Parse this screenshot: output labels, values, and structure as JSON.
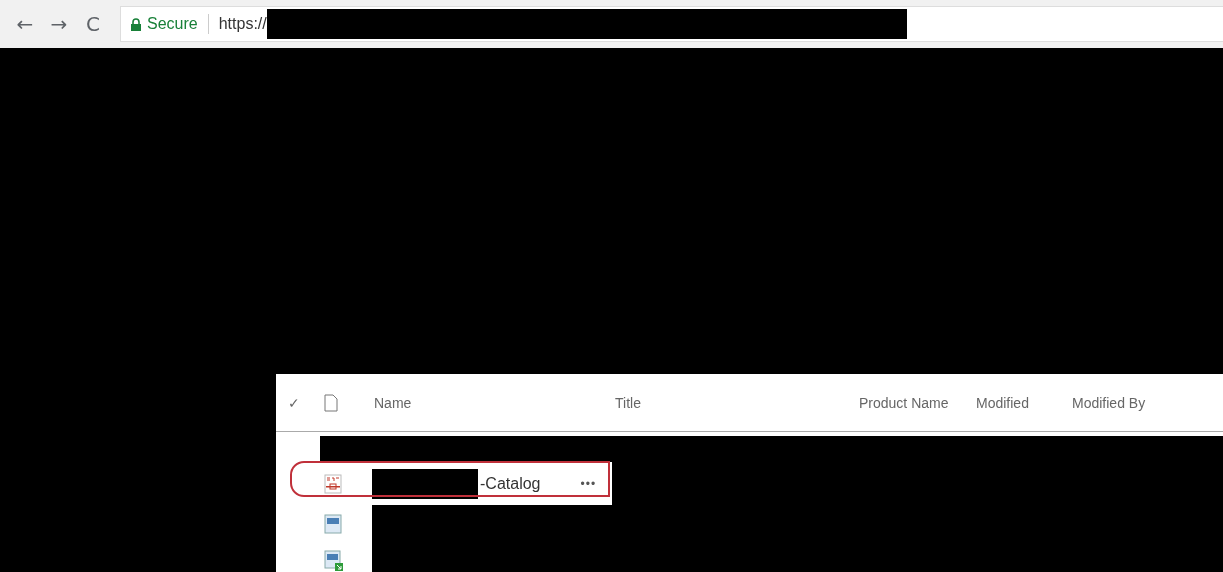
{
  "browser": {
    "back": "←",
    "forward": "→",
    "reload": "C",
    "secure_label": "Secure",
    "url": "https://"
  },
  "list": {
    "columns": [
      {
        "kind": "check",
        "label": "✓"
      },
      {
        "kind": "type"
      },
      {
        "kind": "text",
        "label": "Name"
      },
      {
        "kind": "text",
        "label": "Title"
      },
      {
        "kind": "text",
        "label": "Product Name"
      },
      {
        "kind": "text",
        "label": "Modified"
      },
      {
        "kind": "text",
        "label": "Modified By"
      }
    ],
    "rows": [
      {
        "kind": "redacted"
      },
      {
        "kind": "pdf",
        "name": "-Catalog",
        "menu": "•••",
        "highlighted": true
      },
      {
        "kind": "page"
      },
      {
        "kind": "page-link"
      }
    ]
  }
}
